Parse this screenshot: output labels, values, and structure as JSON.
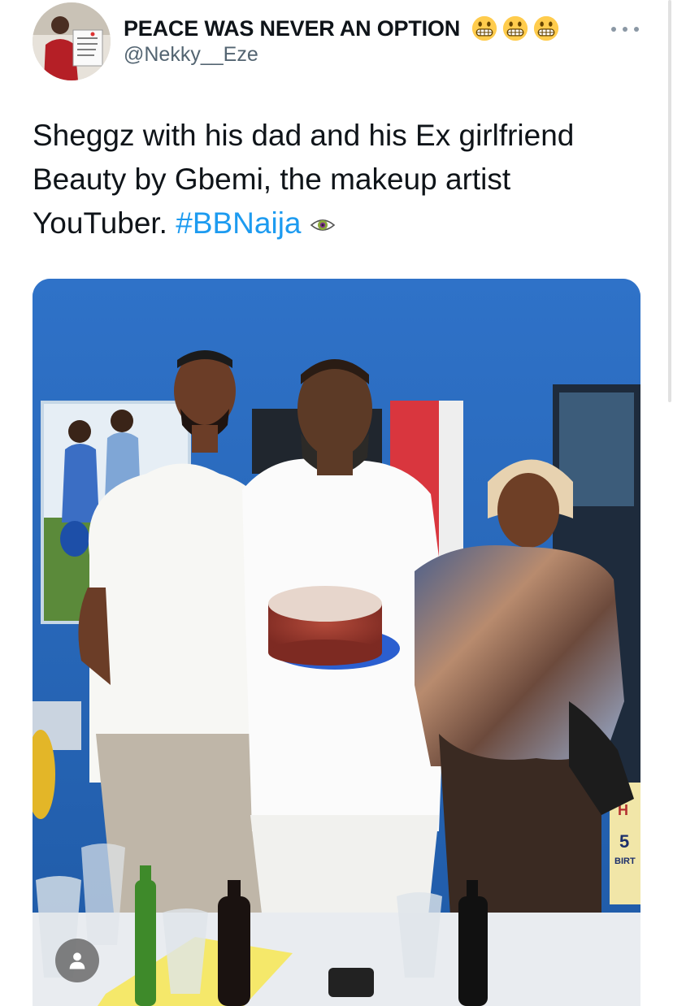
{
  "author": {
    "display_name": "PEACE WAS NEVER AN OPTION",
    "name_emojis": [
      "grimacing-face-emoji",
      "grimacing-face-emoji",
      "grimacing-face-emoji"
    ],
    "handle": "@Nekky__Eze",
    "avatar_icon": "profile-avatar"
  },
  "menu": {
    "icon": "more-options-icon"
  },
  "tweet": {
    "text": "Sheggz with his dad and his Ex girlfriend Beauty by Gbemi, the makeup artist YouTuber. ",
    "hashtag": "#BBNaija",
    "trailing_emoji": "eye-emoji"
  },
  "media": {
    "type": "photo",
    "badge_icon": "person-icon"
  },
  "colors": {
    "link": "#1d9bf0",
    "secondary_text": "#536471",
    "primary_text": "#0f1419"
  }
}
